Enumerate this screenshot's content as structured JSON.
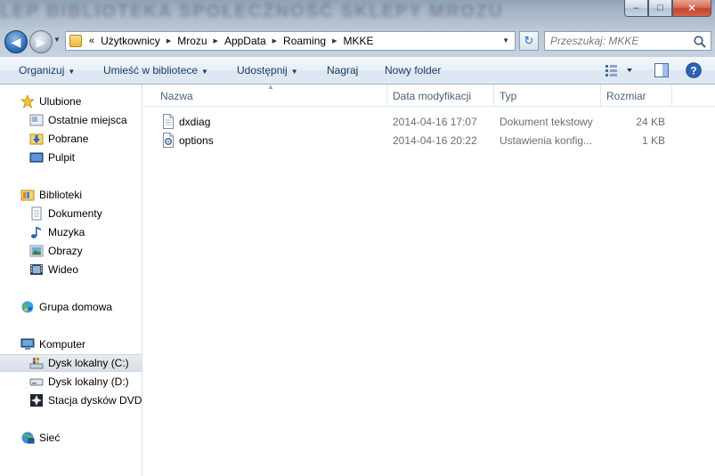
{
  "window": {
    "blurred_title": "LEP BIBLIOTEKA SPOŁECZNOŚĆ SKLEPY MROZU",
    "controls": {
      "minimize": "–",
      "maximize": "□",
      "close": "✕"
    }
  },
  "address": {
    "prefix": "«",
    "crumbs": [
      "Użytkownicy",
      "Mrozu",
      "AppData",
      "Roaming",
      "MKKE"
    ]
  },
  "search": {
    "placeholder": "Przeszukaj: MKKE"
  },
  "toolbar": {
    "organize": "Organizuj",
    "library": "Umieść w bibliotece",
    "share": "Udostępnij",
    "burn": "Nagraj",
    "new_folder": "Nowy folder"
  },
  "nav": {
    "favorites": "Ulubione",
    "recent": "Ostatnie miejsca",
    "downloads": "Pobrane",
    "desktop": "Pulpit",
    "libraries": "Biblioteki",
    "documents": "Dokumenty",
    "music": "Muzyka",
    "pictures": "Obrazy",
    "video": "Wideo",
    "homegroup": "Grupa domowa",
    "computer": "Komputer",
    "disk_c": "Dysk lokalny (C:)",
    "disk_d": "Dysk lokalny (D:)",
    "dvd": "Stacja dysków DVD RW (E:)",
    "network": "Sieć"
  },
  "columns": {
    "name": "Nazwa",
    "modified": "Data modyfikacji",
    "type": "Typ",
    "size": "Rozmiar"
  },
  "files": [
    {
      "name": "dxdiag",
      "modified": "2014-04-16 17:07",
      "type": "Dokument tekstowy",
      "size": "24 KB"
    },
    {
      "name": "options",
      "modified": "2014-04-16 20:22",
      "type": "Ustawienia konfig...",
      "size": "1 KB"
    }
  ]
}
